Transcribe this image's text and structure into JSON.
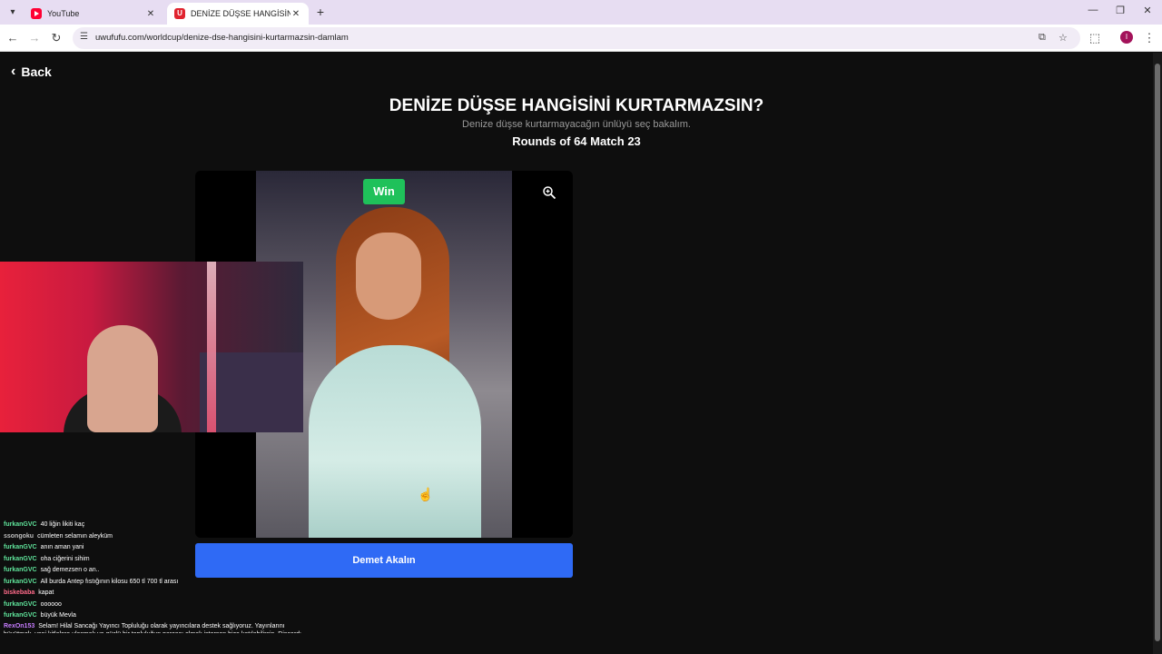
{
  "browser": {
    "tabs": [
      {
        "title": "YouTube",
        "favicon": "youtube-icon"
      },
      {
        "title": "DENİZE DÜŞSE HANGİSİNİ KUR",
        "favicon": "uwufufu-icon"
      }
    ],
    "url": "uwufufu.com/worldcup/denize-dse-hangisini-kurtarmazsin-damlam",
    "profile_initial": "I"
  },
  "page": {
    "back_label": "Back",
    "title": "DENİZE DÜŞSE HANGİSİNİ KURTARMAZSIN?",
    "subtitle": "Denize düşse kurtarmayacağın ünlüyü seç bakalım.",
    "rounds": "Rounds of 64 Match 23",
    "win_label": "Win",
    "candidate_name": "Demet Akalın"
  },
  "chat": {
    "messages": [
      {
        "user": "furkanGVC",
        "text": "40 liğin likiti kaç",
        "color": "#5fe39a"
      },
      {
        "user": "ssongoku",
        "text": "cümleten selamın aleyküm",
        "color": "#bfbfbf"
      },
      {
        "user": "furkanGVC",
        "text": "anın aman yani",
        "color": "#5fe39a"
      },
      {
        "user": "furkanGVC",
        "text": "oha ciğerini sihim",
        "color": "#5fe39a"
      },
      {
        "user": "furkanGVC",
        "text": "sağ demezsen o an..",
        "color": "#5fe39a"
      },
      {
        "user": "furkanGVC",
        "text": "All burda Antep fıstığının kilosu 650 tl 700 tl arası",
        "color": "#5fe39a"
      },
      {
        "user": "biskebaba",
        "text": "kapat",
        "color": "#ff6b8a"
      },
      {
        "user": "furkanGVC",
        "text": "oooooo",
        "color": "#5fe39a"
      },
      {
        "user": "furkanGVC",
        "text": "büyük Mevla",
        "color": "#5fe39a"
      },
      {
        "user": "RexOn153",
        "text": "Selam! Hilal Sancağı Yayıncı Topluluğu olarak yayıncılara destek sağlıyoruz. Yayınlarını büyütmek, yeni kitlelere ulaşmak ve güçlü bir topluluğun parçası olmak istersen bize katılabilirsin. Discord: .gg/hilalsancagi",
        "color": "#c77dff"
      }
    ]
  },
  "colors": {
    "win": "#1fc15a",
    "button": "#2f6af5",
    "background": "#0e0e0e"
  }
}
